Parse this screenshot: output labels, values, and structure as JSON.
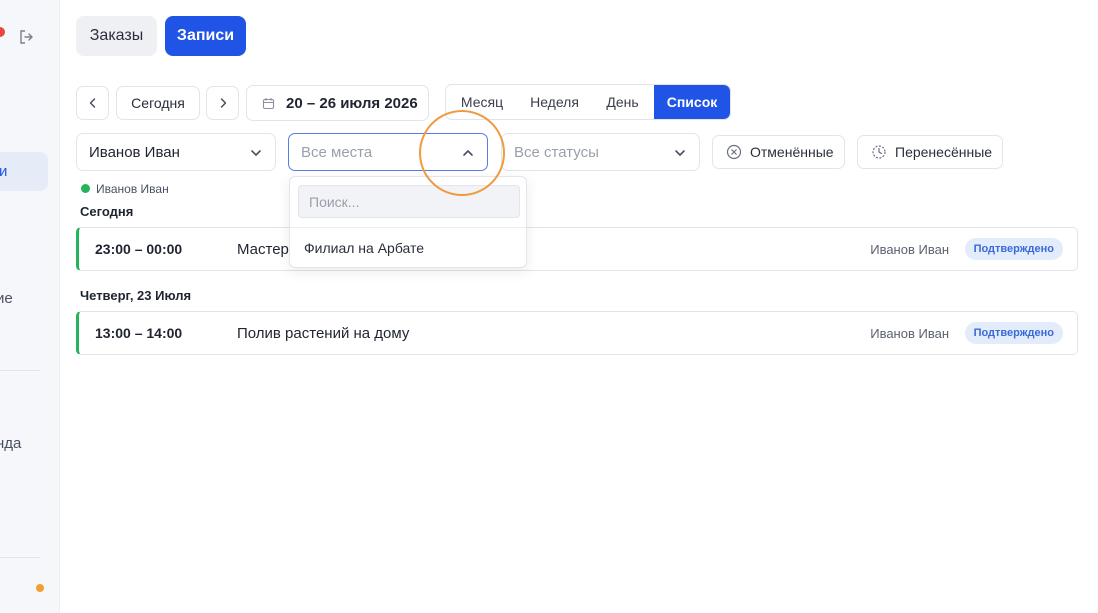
{
  "sidebar": {
    "active_label": "и",
    "item_label_1": "ие",
    "item_label_2": "нда",
    "icons": [
      "logout-icon"
    ]
  },
  "tabs": [
    {
      "label": "Заказы",
      "active": false
    },
    {
      "label": "Записи",
      "active": true
    }
  ],
  "toolbar": {
    "prev_icon": "chevron-left-icon",
    "today_label": "Сегодня",
    "next_icon": "chevron-right-icon",
    "date_icon": "calendar-icon",
    "date_range": "20 – 26 июля 2026",
    "views": [
      {
        "label": "Месяц",
        "active": false
      },
      {
        "label": "Неделя",
        "active": false
      },
      {
        "label": "День",
        "active": false
      },
      {
        "label": "Список",
        "active": true
      }
    ]
  },
  "filters": {
    "employee": {
      "value": "Иванов Иван"
    },
    "places": {
      "placeholder": "Все места",
      "open": true
    },
    "statuses": {
      "placeholder": "Все статусы"
    },
    "cancelled_label": "Отменённые",
    "rescheduled_label": "Перенесённые"
  },
  "dropdown": {
    "search_placeholder": "Поиск...",
    "options": [
      "Филиал на Арбате"
    ]
  },
  "legend": {
    "name": "Иванов Иван",
    "color": "#26b45a"
  },
  "schedule": [
    {
      "day": "Сегодня",
      "events": [
        {
          "time": "23:00 – 00:00",
          "title": "Мастер",
          "person": "Иванов Иван",
          "status": "Подтверждено"
        }
      ]
    },
    {
      "day": "Четверг, 23 Июля",
      "events": [
        {
          "time": "13:00 – 14:00",
          "title": "Полив растений на дому",
          "person": "Иванов Иван",
          "status": "Подтверждено"
        }
      ]
    }
  ],
  "colors": {
    "accent": "#1f54e6",
    "event_bar": "#26b45a",
    "badge_bg": "#e3ecfb",
    "badge_text": "#3a6ad8",
    "highlight": "#ef9a3e"
  }
}
